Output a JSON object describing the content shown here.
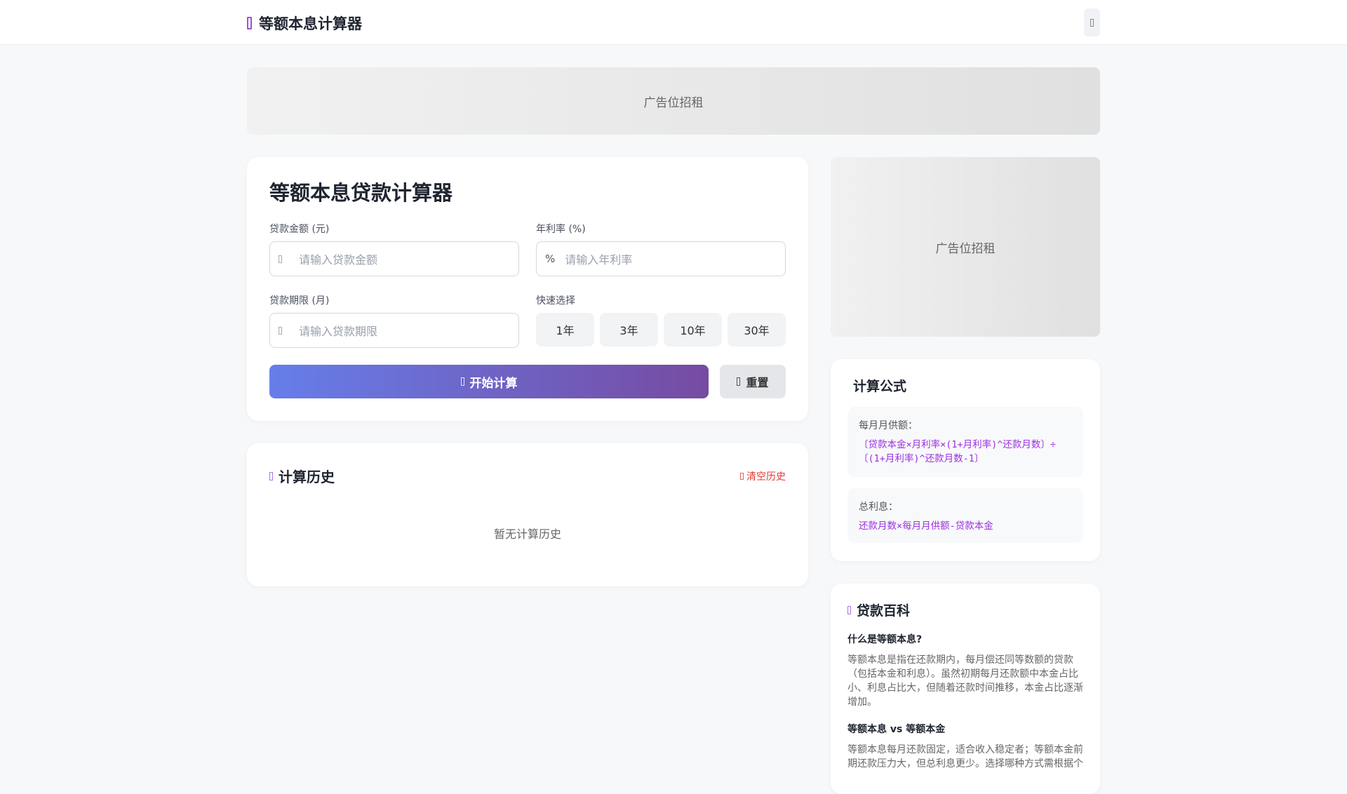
{
  "header": {
    "title": "等额本息计算器"
  },
  "ads": {
    "top": "广告位招租",
    "side": "广告位招租"
  },
  "calculator": {
    "title": "等额本息贷款计算器",
    "amount_label": "贷款金额 (元)",
    "amount_placeholder": "请输入贷款金额",
    "rate_label": "年利率 (%)",
    "rate_symbol": "%",
    "rate_placeholder": "请输入年利率",
    "term_label": "贷款期限 (月)",
    "term_placeholder": "请输入贷款期限",
    "quick_label": "快速选择",
    "quick_options": [
      "1年",
      "3年",
      "10年",
      "30年"
    ],
    "calc_button": "开始计算",
    "reset_button": "重置"
  },
  "history": {
    "title": "计算历史",
    "clear": "清空历史",
    "empty": "暂无计算历史"
  },
  "formula": {
    "title": "计算公式",
    "items": [
      {
        "label": "每月月供额：",
        "formula": "〔贷款本金×月利率×(1+月利率)^还款月数〕÷〔(1+月利率)^还款月数-1〕"
      },
      {
        "label": "总利息：",
        "formula": "还款月数×每月月供额-贷款本金"
      }
    ]
  },
  "wiki": {
    "title": "贷款百科",
    "sections": [
      {
        "heading": "什么是等额本息?",
        "text": "等额本息是指在还款期内，每月偿还同等数额的贷款（包括本金和利息）。虽然初期每月还款额中本金占比小、利息占比大，但随着还款时间推移，本金占比逐渐增加。"
      },
      {
        "heading": "等额本息 vs 等额本金",
        "text": "等额本息每月还款固定，适合收入稳定者；等额本金前期还款压力大，但总利息更少。选择哪种方式需根据个"
      }
    ]
  }
}
